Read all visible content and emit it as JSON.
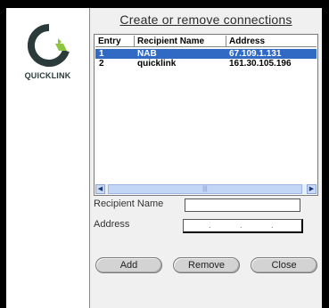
{
  "brand": {
    "name": "QUICKLINK"
  },
  "dialog": {
    "title": "Create or remove connections"
  },
  "table": {
    "headers": [
      "Entry",
      "Recipient Name",
      "Address"
    ],
    "rows": [
      {
        "entry": "1",
        "name": "NAB",
        "address": "67.109.1.131",
        "selected": true
      },
      {
        "entry": "2",
        "name": "quicklink",
        "address": "161.30.105.196",
        "selected": false
      }
    ]
  },
  "form": {
    "recipient_label": "Recipient Name",
    "recipient_value": "",
    "address_label": "Address",
    "address_dots": [
      ".",
      ".",
      "."
    ]
  },
  "buttons": {
    "add": "Add",
    "remove": "Remove",
    "close": "Close"
  },
  "colors": {
    "selection": "#316ac5",
    "logo_green": "#8cc63f",
    "logo_dark": "#2b3a3a"
  },
  "icons": {
    "scroll_left": "scroll-left-arrow-icon",
    "scroll_right": "scroll-right-arrow-icon",
    "logo": "quicklink-logo-icon"
  }
}
